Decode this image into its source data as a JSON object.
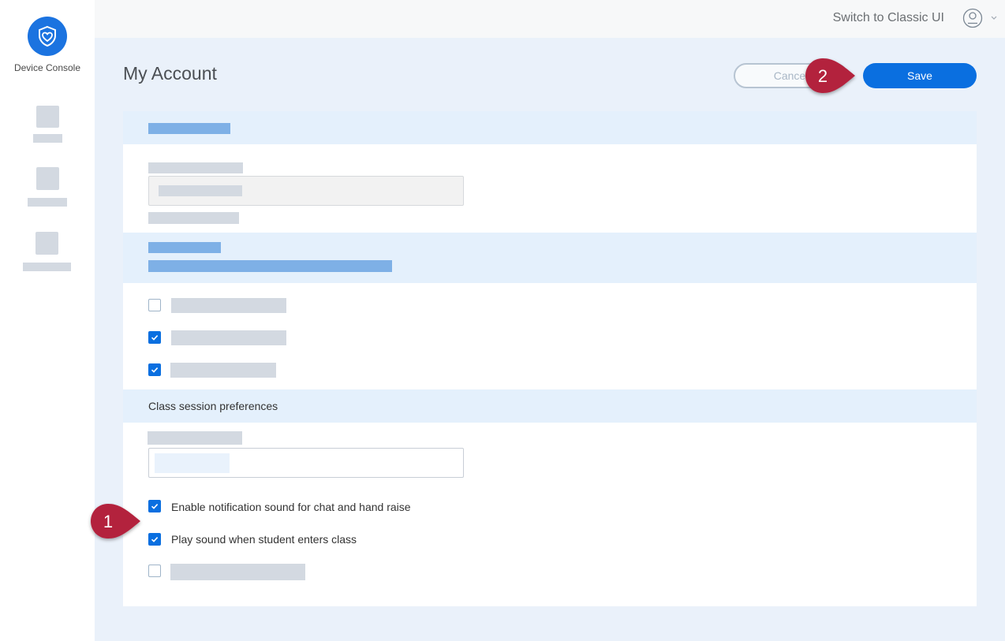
{
  "sidebar": {
    "app_name": "Device Console"
  },
  "topbar": {
    "switch_link": "Switch to Classic UI"
  },
  "header": {
    "title": "My Account",
    "cancel_label": "Cancel",
    "save_label": "Save"
  },
  "class_session": {
    "title": "Class session preferences",
    "options": [
      {
        "label": "Enable notification sound for chat and hand raise",
        "checked": true
      },
      {
        "label": "Play sound when student enters class",
        "checked": true
      }
    ]
  },
  "annotations": {
    "callout_1": "1",
    "callout_2": "2",
    "color": "#b3213e"
  },
  "colors": {
    "primary": "#0a6fe0",
    "page_bg": "#eaf1fa",
    "band": "#e4f0fc"
  }
}
